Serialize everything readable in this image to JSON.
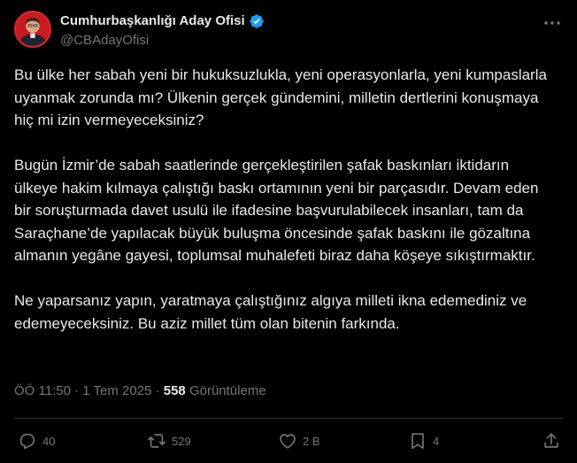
{
  "author": {
    "display_name": "Cumhurbaşkanlığı Aday Ofisi",
    "handle": "@CBAdayOfisi",
    "verified": true,
    "verified_color": "#1d9bf0"
  },
  "tweet": {
    "paragraphs": [
      "Bu ülke her sabah yeni bir hukuksuzlukla, yeni operasyonlarla, yeni kumpaslarla uyanmak zorunda mı? Ülkenin gerçek gündemini, milletin dertlerini konuşmaya hiç mi izin vermeyeceksiniz?",
      "Bugün İzmir’de sabah saatlerinde gerçekleştirilen şafak baskınları iktidarın ülkeye hakim kılmaya çalıştığı baskı ortamının yeni bir parçasıdır. Devam eden bir soruşturmada davet usulü ile ifadesine başvurulabilecek insanları, tam da Saraçhane’de yapılacak büyük buluşma öncesinde şafak baskını ile gözaltına almanın yegâne gayesi, toplumsal muhalefeti biraz daha köşeye sıkıştırmaktır.",
      "Ne yaparsanız yapın, yaratmaya çalıştığınız algıya milleti ikna edemediniz ve edemeyeceksiniz. Bu aziz millet tüm olan bitenin farkında."
    ],
    "time": "ÖÖ 11:50",
    "separator": "·",
    "date": "1 Tem 2025",
    "views_count": "558",
    "views_label": "Görüntüleme"
  },
  "actions": {
    "reply_count": "40",
    "retweet_count": "529",
    "like_count": "2 B",
    "bookmark_count": "4"
  },
  "icons": {
    "more": "more-horizontal-icon",
    "reply": "reply-icon",
    "retweet": "retweet-icon",
    "like": "heart-icon",
    "bookmark": "bookmark-icon",
    "share": "share-icon"
  },
  "colors": {
    "background": "#000000",
    "text": "#e7e9ea",
    "secondary": "#71767b",
    "divider": "#2f3336"
  }
}
